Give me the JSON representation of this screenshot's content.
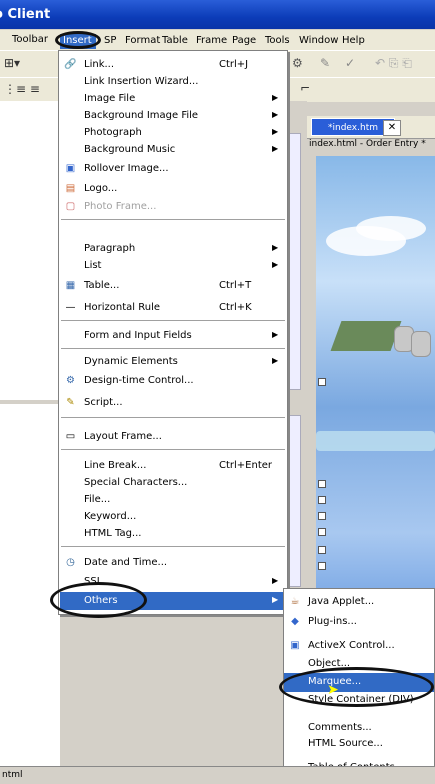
{
  "window": {
    "title": "o Client"
  },
  "menubar": {
    "items": [
      "Toolbar",
      "Insert",
      "SP",
      "Format",
      "Table",
      "Frame",
      "Page",
      "Tools",
      "Window",
      "Help"
    ]
  },
  "document": {
    "tab_label": "*index.htm",
    "close_glyph": "✕",
    "path": "index.html - Order Entry *"
  },
  "insert_menu": {
    "items": [
      {
        "label": "Link...",
        "shortcut": "Ctrl+J",
        "icon": "link-icon",
        "icon_glyph": "🔗"
      },
      {
        "label": "Link Insertion Wizard..."
      },
      {
        "label": "Image File",
        "submenu": true
      },
      {
        "label": "Background Image File",
        "submenu": true
      },
      {
        "label": "Photograph",
        "submenu": true
      },
      {
        "label": "Background Music",
        "submenu": true
      },
      {
        "label": "Rollover Image...",
        "icon": "rollover-image-icon",
        "icon_glyph": "▣"
      },
      {
        "label": "Logo...",
        "icon": "logo-icon",
        "icon_glyph": "▤"
      },
      {
        "label": "Photo Frame...",
        "disabled": true,
        "icon": "photo-frame-icon",
        "icon_glyph": "▢"
      },
      {
        "label": "Paragraph",
        "submenu": true
      },
      {
        "label": "List",
        "submenu": true
      },
      {
        "label": "Table...",
        "shortcut": "Ctrl+T",
        "icon": "table-icon",
        "icon_glyph": "▦"
      },
      {
        "label": "Horizontal Rule",
        "shortcut": "Ctrl+K",
        "icon": "horizontal-rule-icon",
        "icon_glyph": "—"
      },
      {
        "label": "Form and Input Fields",
        "submenu": true
      },
      {
        "label": "Dynamic Elements",
        "submenu": true
      },
      {
        "label": "Design-time Control...",
        "icon": "design-time-control-icon",
        "icon_glyph": "⚙"
      },
      {
        "label": "Script...",
        "icon": "script-icon",
        "icon_glyph": "✎"
      },
      {
        "label": "Layout Frame...",
        "icon": "layout-frame-icon",
        "icon_glyph": "▭"
      },
      {
        "label": "Line Break...",
        "shortcut": "Ctrl+Enter"
      },
      {
        "label": "Special Characters..."
      },
      {
        "label": "File..."
      },
      {
        "label": "Keyword..."
      },
      {
        "label": "HTML Tag..."
      },
      {
        "label": "Date and Time...",
        "icon": "date-time-icon",
        "icon_glyph": "◷"
      },
      {
        "label": "SSI",
        "submenu": true
      },
      {
        "label": "Others",
        "submenu": true,
        "highlighted": true
      }
    ],
    "submenu_arrow": "▶"
  },
  "others_submenu": {
    "items": [
      {
        "label": "Java Applet...",
        "icon": "java-applet-icon",
        "icon_glyph": "☕"
      },
      {
        "label": "Plug-ins...",
        "icon": "plugin-icon",
        "icon_glyph": "◆"
      },
      {
        "label": "ActiveX Control...",
        "icon": "activex-icon",
        "icon_glyph": "▣"
      },
      {
        "label": "Object..."
      },
      {
        "label": "Marquee...",
        "highlighted": true
      },
      {
        "label": "Style Container (DIV)"
      },
      {
        "label": "Comments..."
      },
      {
        "label": "HTML Source..."
      },
      {
        "label": "Table of Contents..."
      }
    ]
  },
  "status": {
    "text": "ntml"
  },
  "colors": {
    "highlight": "#316ac5",
    "titlebar": "#0c3cb8"
  }
}
